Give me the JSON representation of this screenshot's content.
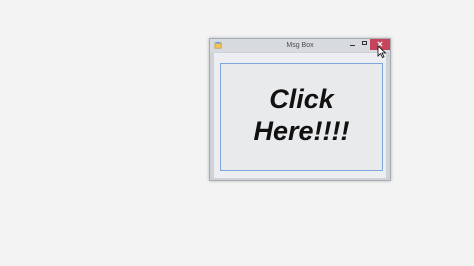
{
  "window": {
    "title": "Msg Box",
    "controls": {
      "minimize_icon": "minimize-icon",
      "maximize_icon": "maximize-icon",
      "close_icon": "close-icon",
      "close_glyph": "✕",
      "close_color": "#c6455a"
    }
  },
  "main_button": {
    "label": "Click\nHere!!!!"
  },
  "colors": {
    "desktop": "#f3f3f3",
    "window_frame": "#cfd3d8",
    "button_border": "#7fa6d9"
  }
}
